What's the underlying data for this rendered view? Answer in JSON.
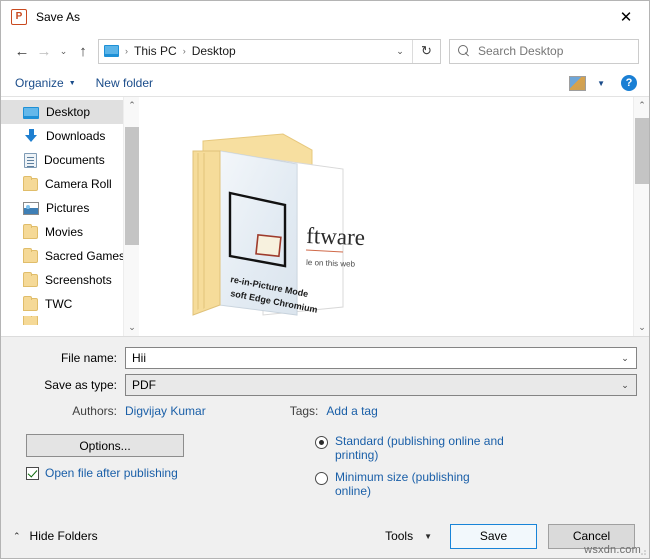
{
  "window": {
    "title": "Save As",
    "app_icon": "powerpoint-icon",
    "app_icon_letter": "P",
    "close_label": "✕"
  },
  "nav": {
    "back_icon": "back-arrow-icon",
    "forward_icon": "forward-arrow-icon",
    "recent_icon": "recent-locations-icon",
    "up_icon": "up-arrow-icon",
    "back_glyph": "←",
    "forward_glyph": "→",
    "recent_glyph": "⌄",
    "up_glyph": "↑",
    "breadcrumb": {
      "root_icon": "this-pc-icon",
      "items": [
        "This PC",
        "Desktop"
      ],
      "separator": "›",
      "dropdown_glyph": "⌄"
    },
    "refresh_glyph": "↻",
    "refresh_icon": "refresh-icon"
  },
  "search": {
    "placeholder": "Search Desktop",
    "icon": "search-icon"
  },
  "toolbar": {
    "organize_label": "Organize",
    "organize_caret": "▼",
    "new_folder_label": "New folder",
    "view_icon": "view-layout-icon",
    "view_caret": "▼",
    "help_icon": "help-icon",
    "help_glyph": "?"
  },
  "sidebar": {
    "items": [
      {
        "label": "Desktop",
        "icon": "desktop-icon",
        "pinned": true,
        "selected": true
      },
      {
        "label": "Downloads",
        "icon": "downloads-icon",
        "pinned": true,
        "selected": false
      },
      {
        "label": "Documents",
        "icon": "documents-icon",
        "pinned": true,
        "selected": false
      },
      {
        "label": "Camera Roll",
        "icon": "folder-icon",
        "pinned": true,
        "selected": false
      },
      {
        "label": "Pictures",
        "icon": "pictures-icon",
        "pinned": true,
        "selected": false
      },
      {
        "label": "Movies",
        "icon": "folder-icon",
        "pinned": false,
        "selected": false
      },
      {
        "label": "Sacred Games",
        "icon": "folder-icon",
        "pinned": false,
        "selected": false
      },
      {
        "label": "Screenshots",
        "icon": "folder-icon",
        "pinned": false,
        "selected": false
      },
      {
        "label": "TWC",
        "icon": "folder-icon",
        "pinned": false,
        "selected": false
      }
    ],
    "scroll_up_glyph": "⌃",
    "scroll_down_glyph": "⌄"
  },
  "file_list": {
    "thumbnail_alt": "folder-with-documents-thumbnail",
    "thumbnail_text_lines": [
      "ftware",
      "le on this web",
      "re-in-Picture Mode",
      "soft Edge Chromium"
    ],
    "scroll_up_glyph": "⌃",
    "scroll_down_glyph": "⌄"
  },
  "form": {
    "file_name_label": "File name:",
    "file_name_value": "Hii",
    "save_as_type_label": "Save as type:",
    "save_as_type_value": "PDF",
    "combo_chevron": "⌄",
    "authors_label": "Authors:",
    "authors_value": "Digvijay Kumar",
    "tags_label": "Tags:",
    "tags_value": "Add a tag",
    "options_button": "Options...",
    "open_after_publishing_label": "Open file after publishing",
    "open_after_publishing_checked": true,
    "optimize": {
      "standard_label": "Standard (publishing online and printing)",
      "standard_selected": true,
      "minimum_label": "Minimum size (publishing online)",
      "minimum_selected": false
    }
  },
  "footer": {
    "hide_folders_label": "Hide Folders",
    "hide_folders_caret": "⌃",
    "tools_label": "Tools",
    "tools_caret": "▼",
    "save_label": "Save",
    "cancel_label": "Cancel",
    "watermark": "wsxdn.com"
  },
  "colors": {
    "accent_blue": "#1a5fa8",
    "link_blue": "#1a4c8a",
    "primary_button_border": "#1884d8",
    "folder_yellow": "#f5d997",
    "selected_row": "#e0e0e0"
  }
}
